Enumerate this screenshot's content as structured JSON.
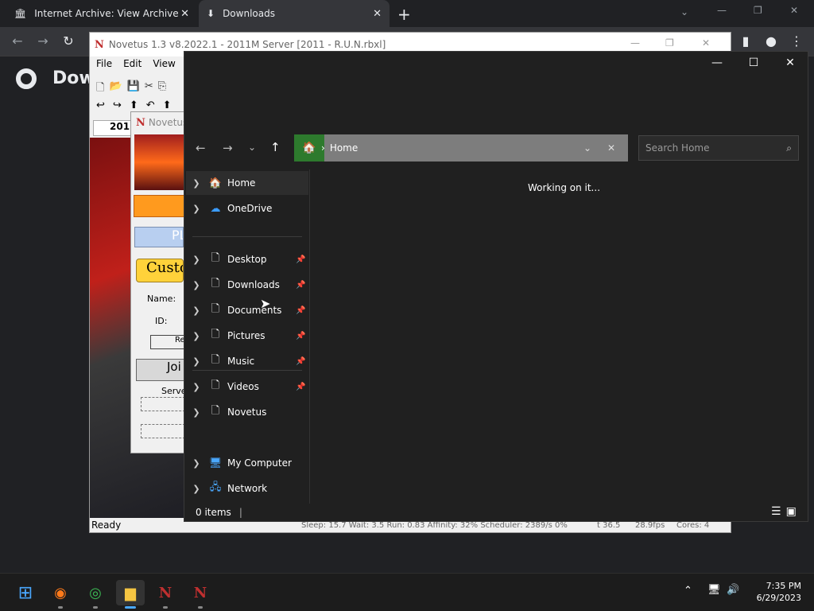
{
  "browser": {
    "tabs": [
      {
        "label": "Internet Archive: View Archive",
        "icon": "archive-icon",
        "active": false
      },
      {
        "label": "Downloads",
        "icon": "download-icon",
        "active": true
      }
    ],
    "new_tab": "+",
    "page_title": "Dow"
  },
  "novetus": {
    "title": "Novetus 1.3 v8.2022.1 - 2011M Server [2011 - R.U.N.rbxl]",
    "menu": [
      "File",
      "Edit",
      "View"
    ],
    "tab_label": "201",
    "sub_title": "Novetus",
    "launcher": {
      "play_label": "PL",
      "custom_label": "Custo",
      "name_label": "Name:",
      "id_label": "ID:",
      "regen_label": "Re",
      "join_label": "Joi",
      "server_label": "Serve"
    },
    "status": {
      "ready": "Ready",
      "perf": "Sleep: 15.7 Wait: 3.5 Run: 0.83 Affinity: 32% Scheduler: 2389/s 0%",
      "t": "t 36.5",
      "fps": "28.9fps",
      "cores": "Cores: 4"
    }
  },
  "explorer": {
    "address_location": "Home",
    "search_placeholder": "Search Home",
    "status_text": "Working on it...",
    "item_count": "0 items",
    "sidebar": [
      {
        "label": "Home",
        "icon": "home-icon",
        "pinned": false,
        "selected": true
      },
      {
        "label": "OneDrive",
        "icon": "cloud-icon",
        "pinned": false
      },
      {
        "label": "Desktop",
        "icon": "file-icon",
        "pinned": true
      },
      {
        "label": "Downloads",
        "icon": "file-icon",
        "pinned": true
      },
      {
        "label": "Documents",
        "icon": "file-icon",
        "pinned": true
      },
      {
        "label": "Pictures",
        "icon": "file-icon",
        "pinned": true
      },
      {
        "label": "Music",
        "icon": "file-icon",
        "pinned": true
      },
      {
        "label": "Videos",
        "icon": "file-icon",
        "pinned": true
      },
      {
        "label": "Novetus",
        "icon": "file-icon",
        "pinned": false
      },
      {
        "label": "My Computer",
        "icon": "computer-icon",
        "pinned": false
      },
      {
        "label": "Network",
        "icon": "network-icon",
        "pinned": false
      }
    ]
  },
  "taskbar": {
    "apps": [
      "start-icon",
      "firefox-icon",
      "chrome-icon",
      "file-explorer-icon",
      "novetus-icon",
      "novetus-icon"
    ],
    "time": "7:35 PM",
    "date": "6/29/2023"
  },
  "colors": {
    "accent": "#2d7a2d",
    "dark_bg": "#202020",
    "browser_bg": "#202124"
  }
}
